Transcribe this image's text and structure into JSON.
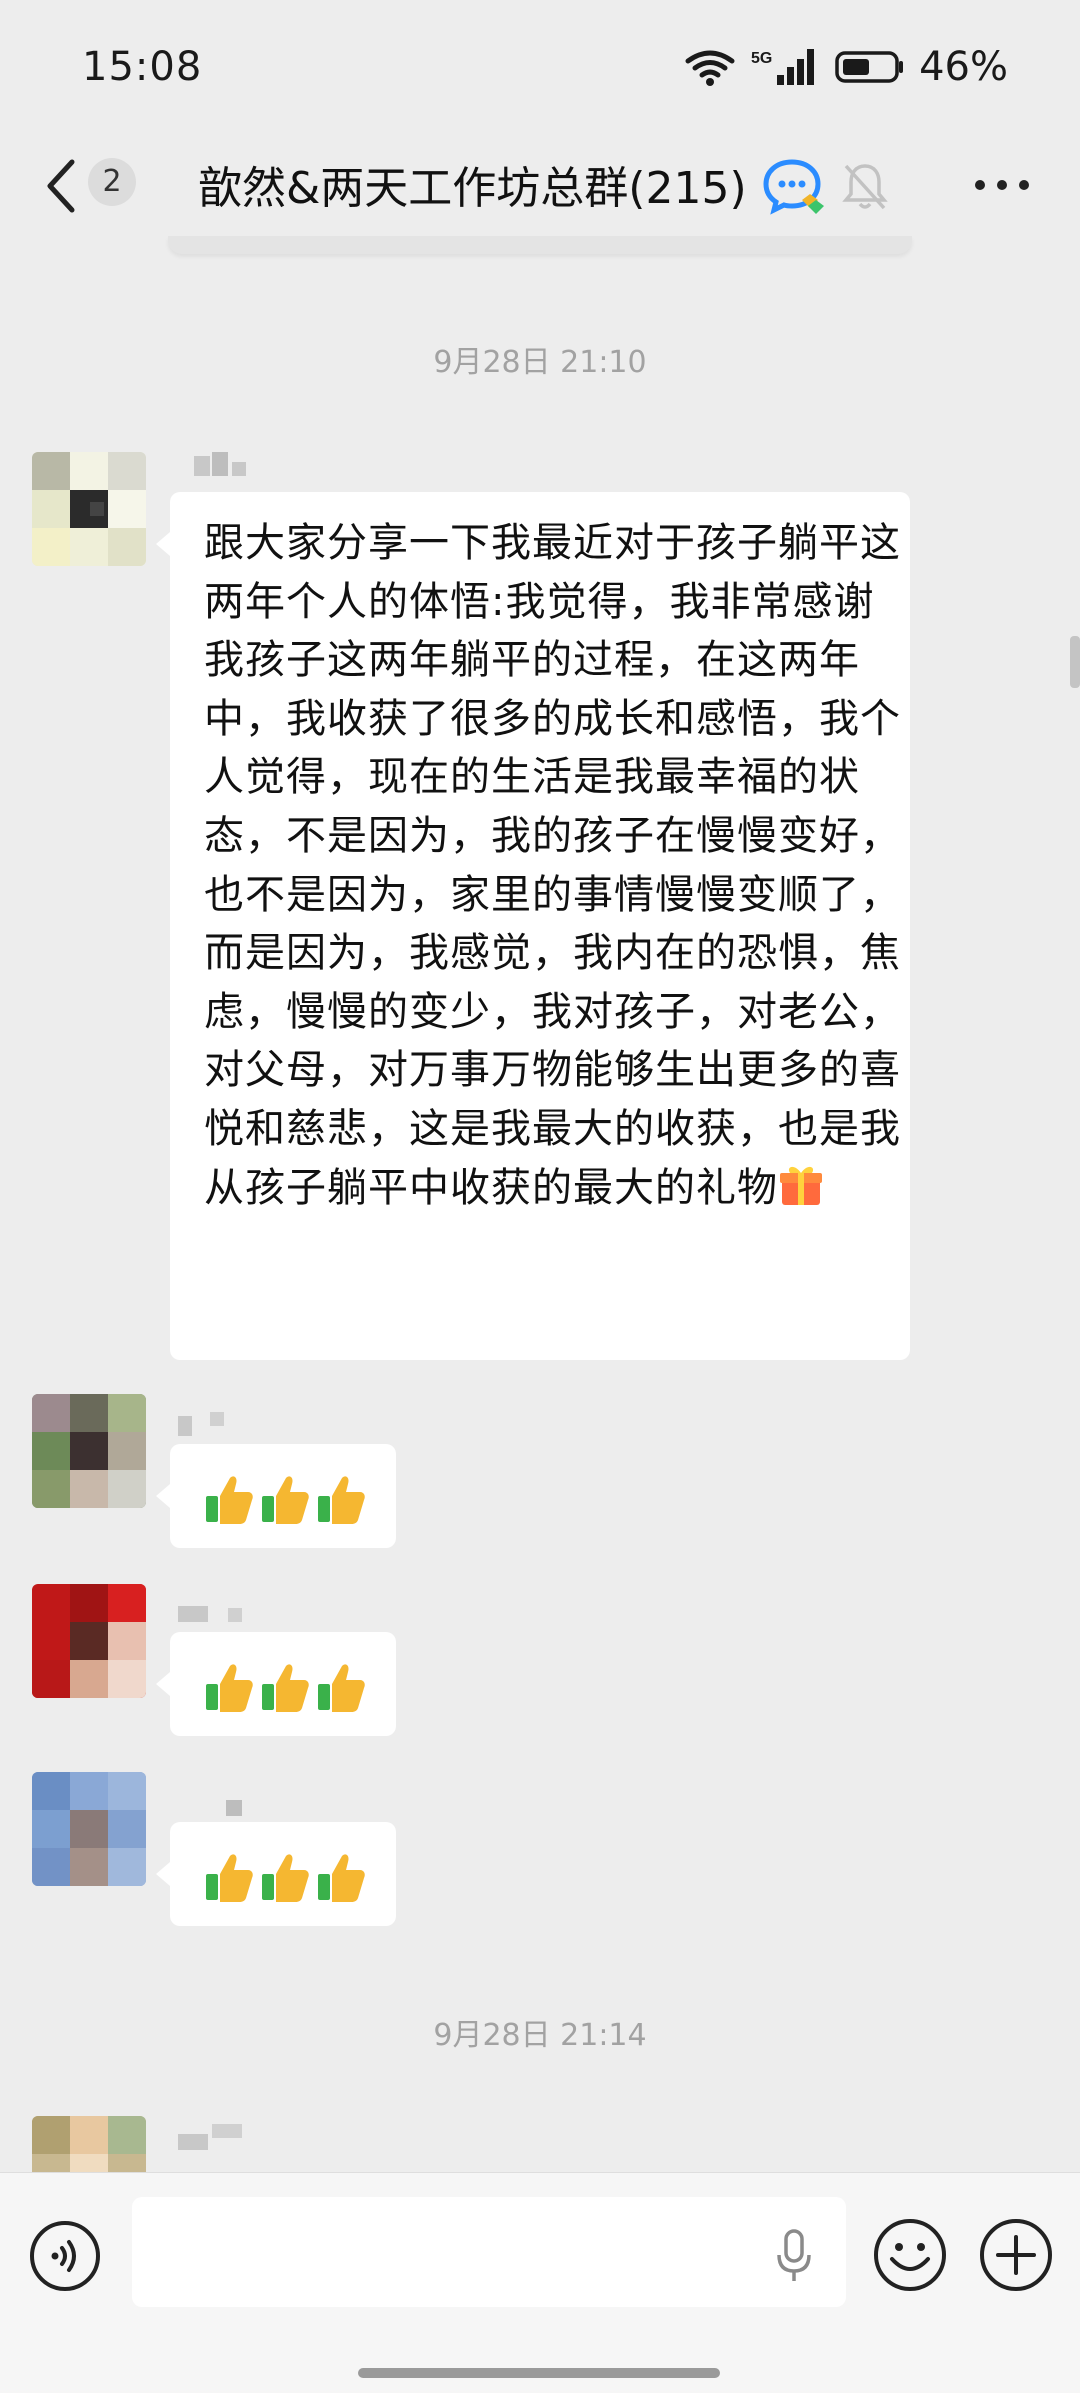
{
  "status": {
    "time": "15:08",
    "network": "5G",
    "battery": "46%"
  },
  "header": {
    "back_label": "",
    "unread_count": "2",
    "title": "歆然&两天工作坊总群(215)"
  },
  "messages": [
    {
      "timestamp": "9月28日 21:10",
      "text": "跟大家分享一下我最近对于孩子躺平这两年个人的体悟:我觉得，我非常感谢我孩子这两年躺平的过程，在这两年中，我收获了很多的成长和感悟，我个人觉得，现在的生活是我最幸福的状态，不是因为，我的孩子在慢慢变好，也不是因为，家里的事情慢慢变顺了，而是因为，我感觉，我内在的恐惧，焦虑，慢慢的变少，我对孩子，对老公，对父母，对万事万物能够生出更多的喜悦和慈悲，这是我最大的收获，也是我从孩子躺平中收获的最大的礼物",
      "emoji": "gift-icon"
    },
    {
      "reply_emoji": "thumbs-up-icon",
      "count": 3
    },
    {
      "reply_emoji": "thumbs-up-icon",
      "count": 3
    },
    {
      "reply_emoji": "thumbs-up-icon",
      "count": 3
    }
  ],
  "timestamp_2": "9月28日 21:14",
  "input": {
    "placeholder": ""
  },
  "icons": {
    "back": "chevron-left-icon",
    "group": "group-chat-icon",
    "mute": "mute-bell-icon",
    "more": "more-icon",
    "voice": "voice-input-icon",
    "mic": "microphone-icon",
    "emoji": "emoji-icon",
    "plus": "plus-icon"
  },
  "colors": {
    "background": "#ededed",
    "bubble": "#ffffff",
    "timestamp": "#a2a2a2"
  }
}
